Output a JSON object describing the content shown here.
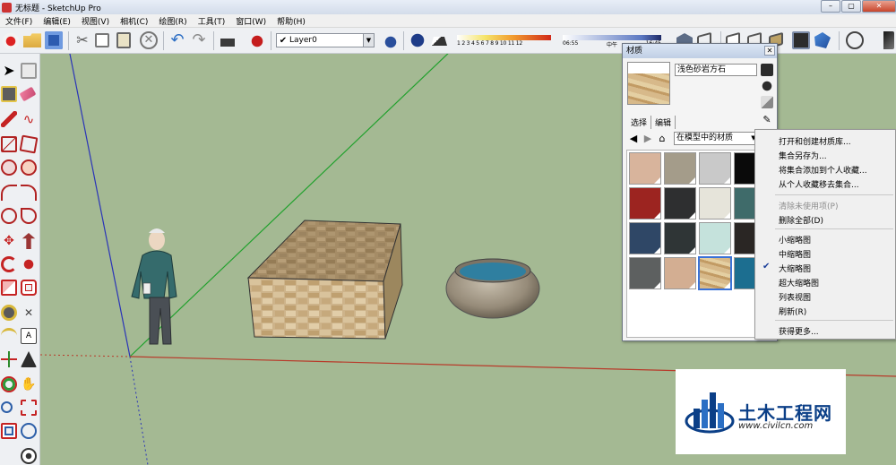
{
  "window": {
    "title": "无标题 - SketchUp Pro",
    "minimize": "–",
    "maximize": "▢",
    "close": "✕"
  },
  "menu": [
    "文件(F)",
    "编辑(E)",
    "视图(V)",
    "相机(C)",
    "绘图(R)",
    "工具(T)",
    "窗口(W)",
    "帮助(H)"
  ],
  "toolbar": {
    "layer_check": "✔",
    "layer_value": "Layer0",
    "shadow_scale_labels": "1 2 3 4 5 6 7 8 9 10 11 12",
    "time_labels": [
      "06:55",
      "中午",
      "16:45"
    ]
  },
  "materials_panel": {
    "title": "材质",
    "material_name": "浅色砂岩方石",
    "tabs": [
      "选择",
      "编辑"
    ],
    "library": "在模型中的材质",
    "swatch_colors": [
      "#d8b49c",
      "#a49c8a",
      "#c9c9c9",
      "#0a0a0a",
      "#9c2420",
      "#2e2f30",
      "#e6e4da",
      "#3f6b6a",
      "#2f4766",
      "#2f3536",
      "#c5e2dc",
      "#2a2624",
      "#5d6060",
      "#d3ae92",
      "#d8c29a",
      "#1c6e90"
    ],
    "selected_swatch": 14
  },
  "context_menu": {
    "items": [
      "打开和创建材质库...",
      "集合另存为...",
      "将集合添加到个人收藏...",
      "从个人收藏移去集合...",
      "清除未使用项(P)",
      "删除全部(D)",
      "小缩略图",
      "中缩略图",
      "大缩略图",
      "超大缩略图",
      "列表视图",
      "刷新(R)",
      "获得更多..."
    ],
    "check": "✔"
  },
  "watermark": {
    "name": "土木工程网",
    "url": "www.civilcn.com"
  },
  "colors": {
    "viewport_bg": "#a4b993",
    "axis_red": "#b83a2a",
    "axis_green": "#21a12d",
    "axis_blue": "#2a34b8",
    "accent": "#3a72d8"
  }
}
